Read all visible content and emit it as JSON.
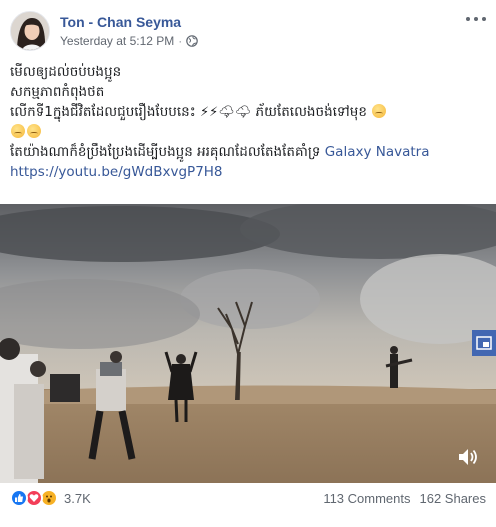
{
  "post": {
    "author": "Ton - Chan Seyma",
    "timestamp": "Yesterday at 5:12 PM",
    "separator": "·",
    "privacy_icon": "globe-icon",
    "more_icon": "more-options-icon"
  },
  "text": {
    "line1": "មើលឲ្យដល់ចប់បងប្អូន",
    "line2": "សកម្មភាពកំពុងថត",
    "line3_prefix": "លើកទី1ក្នុងជីវិតដែលជួបរឿងបែបនេះ",
    "line3_emoji": "⚡⚡🌩🌩",
    "line3_suffix": "ភ័យតែលេងចង់ទៅមុខ",
    "line4_prefix": "តែយ៉ាងណាក៏ខំប្រឹងប្រែងដើម្បីបងប្អូន អរគុណដែលតែងតែគាំទ្រ",
    "line4_link": "Galaxy Navatra",
    "url": "https://youtu.be/gWdBxvgP7H8"
  },
  "media": {
    "expand_icon": "expand-icon",
    "volume_icon": "volume-icon"
  },
  "footer": {
    "reaction_icons": [
      "like-icon",
      "love-icon",
      "wow-icon"
    ],
    "reaction_count": "3.7K",
    "comments": "113 Comments",
    "shares": "162 Shares"
  },
  "colors": {
    "link": "#385898",
    "meta": "#616770",
    "like": "#1877f2",
    "love": "#f33e58",
    "wow": "#f7b125",
    "expand_bg": "#4267b2"
  }
}
